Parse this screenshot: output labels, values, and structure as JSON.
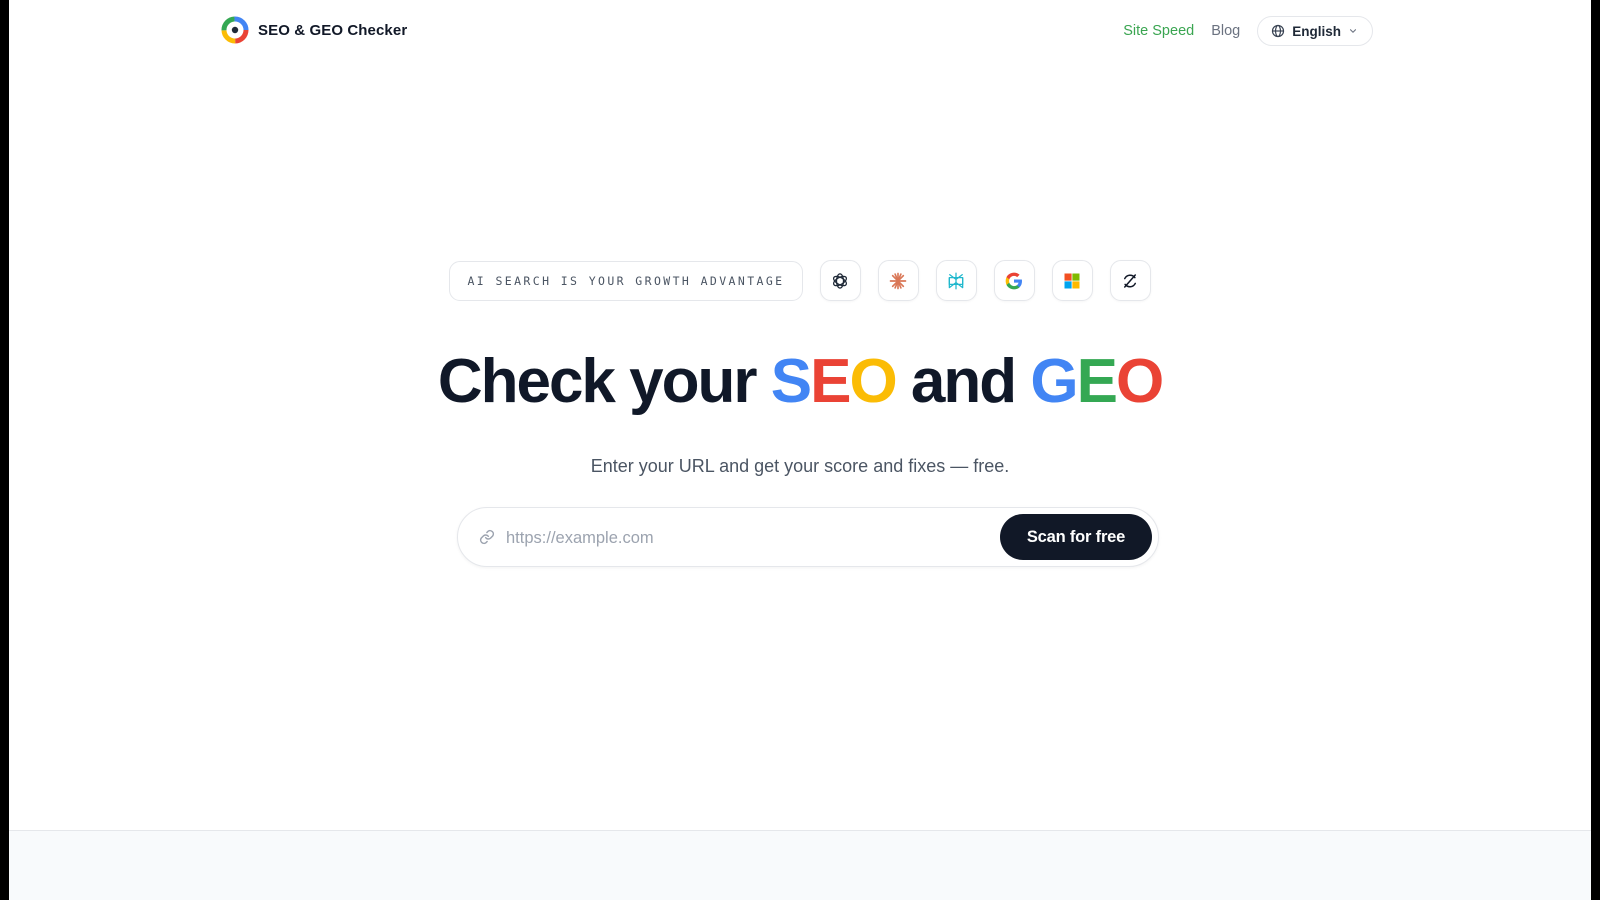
{
  "header": {
    "brand_name": "SEO & GEO Checker",
    "nav": {
      "site_speed": "Site Speed",
      "blog": "Blog"
    },
    "language": "English"
  },
  "hero": {
    "tagline": "AI SEARCH IS YOUR GROWTH ADVANTAGE",
    "engines": [
      "openai-icon",
      "claude-icon",
      "perplexity-icon",
      "google-icon",
      "microsoft-icon",
      "refresh-icon"
    ],
    "headline": {
      "prefix": "Check your ",
      "seo_s": "S",
      "seo_e": "E",
      "seo_o": "O",
      "middle": " and ",
      "geo_g": "G",
      "geo_e": "E",
      "geo_o": "O"
    },
    "subtitle": "Enter your URL and get your score and fixes — free.",
    "search": {
      "placeholder": "https://example.com",
      "value": "",
      "button": "Scan for free"
    }
  },
  "colors": {
    "blue": "#4285f4",
    "red": "#ea4335",
    "yellow": "#fbbc05",
    "green": "#34a853",
    "nav_active": "#3aa551",
    "dark": "#111827"
  }
}
